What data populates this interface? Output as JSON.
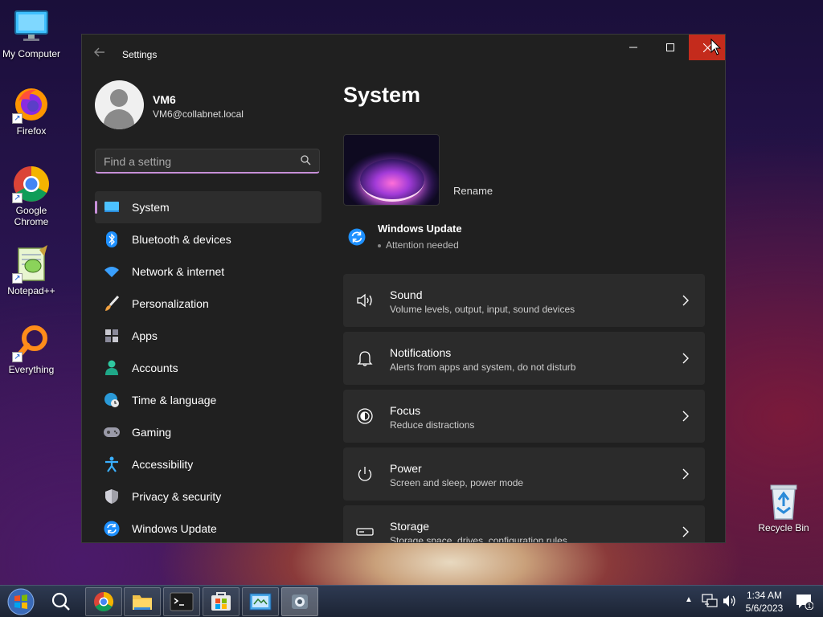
{
  "desktop": {
    "icons": [
      {
        "label": "My Computer"
      },
      {
        "label": "Firefox"
      },
      {
        "label": "Google Chrome"
      },
      {
        "label": "Notepad++"
      },
      {
        "label": "Everything"
      },
      {
        "label": "Recycle Bin"
      }
    ]
  },
  "window": {
    "title": "Settings",
    "minimize_glyph": "—",
    "maximize_glyph": "☐",
    "close_glyph": "✕"
  },
  "user": {
    "name": "VM6",
    "email": "VM6@collabnet.local"
  },
  "search": {
    "placeholder": "Find a setting",
    "value": ""
  },
  "nav": {
    "items": [
      {
        "label": "System",
        "icon": "monitor-icon",
        "active": true
      },
      {
        "label": "Bluetooth & devices",
        "icon": "bluetooth-icon"
      },
      {
        "label": "Network & internet",
        "icon": "wifi-icon"
      },
      {
        "label": "Personalization",
        "icon": "brush-icon"
      },
      {
        "label": "Apps",
        "icon": "apps-icon"
      },
      {
        "label": "Accounts",
        "icon": "person-icon"
      },
      {
        "label": "Time & language",
        "icon": "globe-clock-icon"
      },
      {
        "label": "Gaming",
        "icon": "gamepad-icon"
      },
      {
        "label": "Accessibility",
        "icon": "accessibility-icon"
      },
      {
        "label": "Privacy & security",
        "icon": "shield-icon"
      },
      {
        "label": "Windows Update",
        "icon": "update-icon"
      }
    ]
  },
  "main": {
    "title": "System",
    "rename_label": "Rename",
    "windows_update": {
      "title": "Windows Update",
      "status": "Attention needed"
    },
    "cards": [
      {
        "title": "Sound",
        "subtitle": "Volume levels, output, input, sound devices",
        "icon": "speaker-icon"
      },
      {
        "title": "Notifications",
        "subtitle": "Alerts from apps and system, do not disturb",
        "icon": "bell-icon"
      },
      {
        "title": "Focus",
        "subtitle": "Reduce distractions",
        "icon": "focus-icon"
      },
      {
        "title": "Power",
        "subtitle": "Screen and sleep, power mode",
        "icon": "power-icon"
      },
      {
        "title": "Storage",
        "subtitle": "Storage space, drives, configuration rules",
        "icon": "storage-icon"
      }
    ]
  },
  "taskbar": {
    "time": "1:34 AM",
    "date": "5/6/2023",
    "notification_count": "1"
  },
  "colors": {
    "accent": "#c78fd8",
    "close_red": "#c42b1c",
    "window_bg": "#202020",
    "card_bg": "#2b2b2b"
  }
}
